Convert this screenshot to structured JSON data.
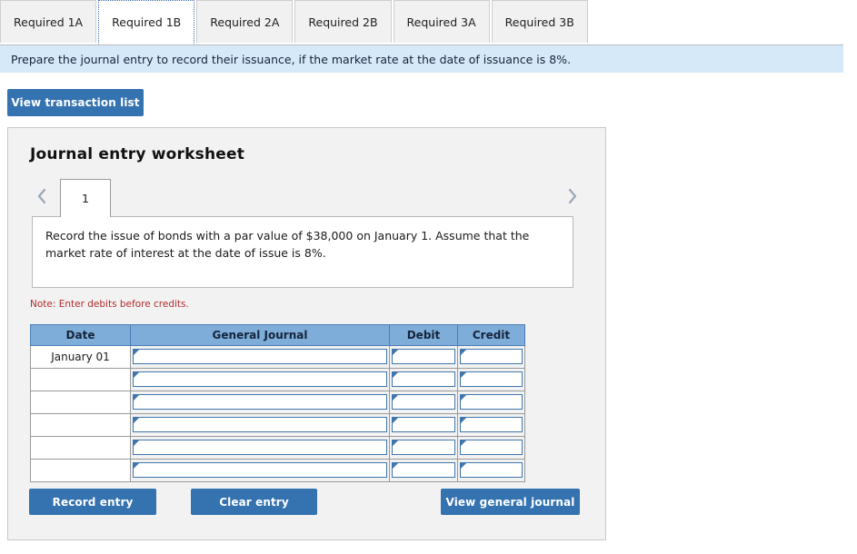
{
  "tabs": [
    {
      "label": "Required 1A",
      "active": false
    },
    {
      "label": "Required 1B",
      "active": true
    },
    {
      "label": "Required 2A",
      "active": false
    },
    {
      "label": "Required 2B",
      "active": false
    },
    {
      "label": "Required 3A",
      "active": false
    },
    {
      "label": "Required 3B",
      "active": false
    }
  ],
  "infobar": {
    "text": "Prepare the journal entry to record their issuance, if the market rate at the date of issuance is 8%."
  },
  "toolbar": {
    "view_transaction_list_label": "View transaction list"
  },
  "worksheet": {
    "title": "Journal entry worksheet",
    "prev_icon": "chevron-left-icon",
    "next_icon": "chevron-right-icon",
    "page_tabs": [
      "1"
    ],
    "description": "Record the issue of bonds with a par value of $38,000 on January 1. Assume that the market rate of interest at the date of issue is 8%.",
    "note": "Note: Enter debits before credits.",
    "table": {
      "columns": [
        "Date",
        "General Journal",
        "Debit",
        "Credit"
      ],
      "rows": [
        {
          "date": "January 01",
          "general_journal": "",
          "debit": "",
          "credit": ""
        },
        {
          "date": "",
          "general_journal": "",
          "debit": "",
          "credit": ""
        },
        {
          "date": "",
          "general_journal": "",
          "debit": "",
          "credit": ""
        },
        {
          "date": "",
          "general_journal": "",
          "debit": "",
          "credit": ""
        },
        {
          "date": "",
          "general_journal": "",
          "debit": "",
          "credit": ""
        },
        {
          "date": "",
          "general_journal": "",
          "debit": "",
          "credit": ""
        }
      ]
    },
    "buttons": {
      "record_entry_label": "Record entry",
      "clear_entry_label": "Clear entry",
      "view_general_journal_label": "View general journal"
    }
  },
  "colors": {
    "button_blue": "#3572b0",
    "table_header_blue": "#7fadda",
    "infobar_blue": "#d6e9f8",
    "note_red": "#b52b2b",
    "panel_gray": "#f2f2f2"
  }
}
